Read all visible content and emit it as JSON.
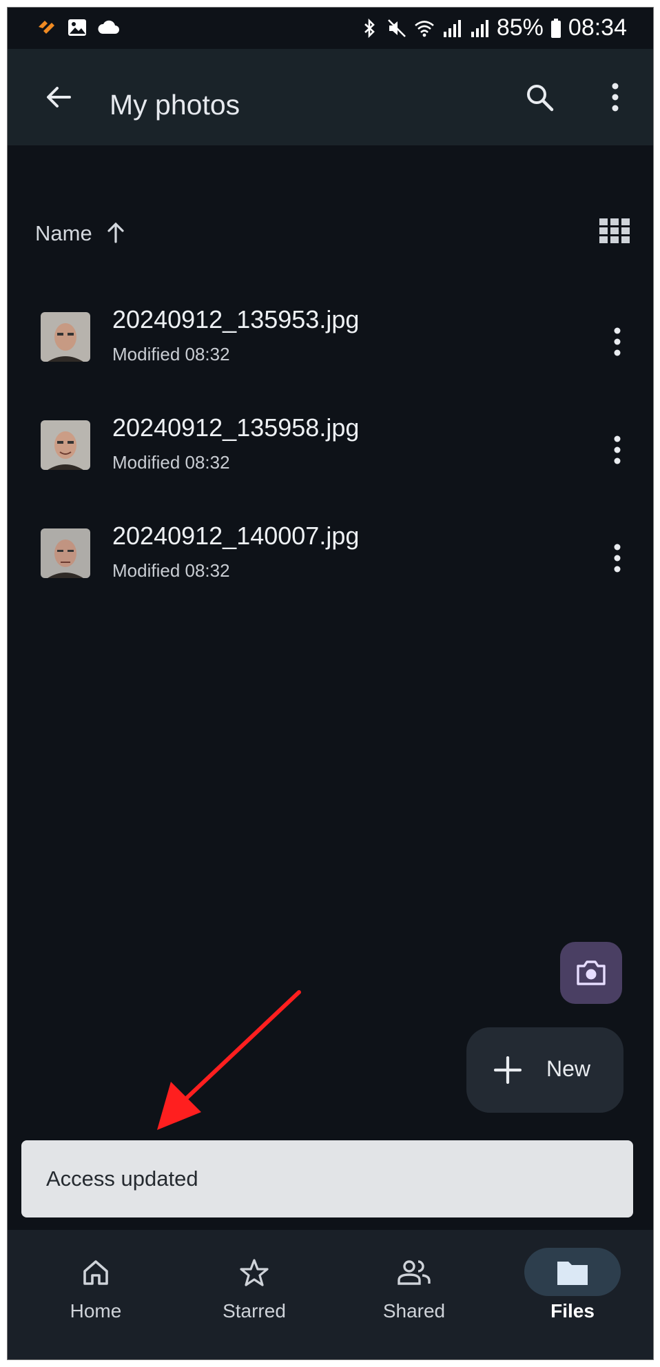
{
  "status_bar": {
    "battery": "85%",
    "time": "08:34"
  },
  "app_bar": {
    "title": "My photos",
    "back_icon": "arrow-left-icon",
    "search_icon": "search-icon",
    "more_icon": "more-vert-icon"
  },
  "sort": {
    "label": "Name",
    "direction_icon": "arrow-up-icon",
    "view_icon": "grid-view-icon"
  },
  "files": [
    {
      "name": "20240912_135953.jpg",
      "meta": "Modified 08:32"
    },
    {
      "name": "20240912_135958.jpg",
      "meta": "Modified 08:32"
    },
    {
      "name": "20240912_140007.jpg",
      "meta": "Modified 08:32"
    }
  ],
  "fab": {
    "camera_icon": "camera-icon",
    "new_label": "New"
  },
  "snackbar": {
    "message": "Access updated"
  },
  "bottom_nav": {
    "items": [
      {
        "label": "Home",
        "icon": "home-icon"
      },
      {
        "label": "Starred",
        "icon": "star-icon"
      },
      {
        "label": "Shared",
        "icon": "people-icon"
      },
      {
        "label": "Files",
        "icon": "folder-icon",
        "active": true
      }
    ]
  },
  "colors": {
    "background": "#0e1218",
    "app_bar": "#1a2329",
    "camera_fab": "#4a3f63",
    "snackbar": "#e2e4e7",
    "annotation_arrow": "#ff1f1f"
  }
}
